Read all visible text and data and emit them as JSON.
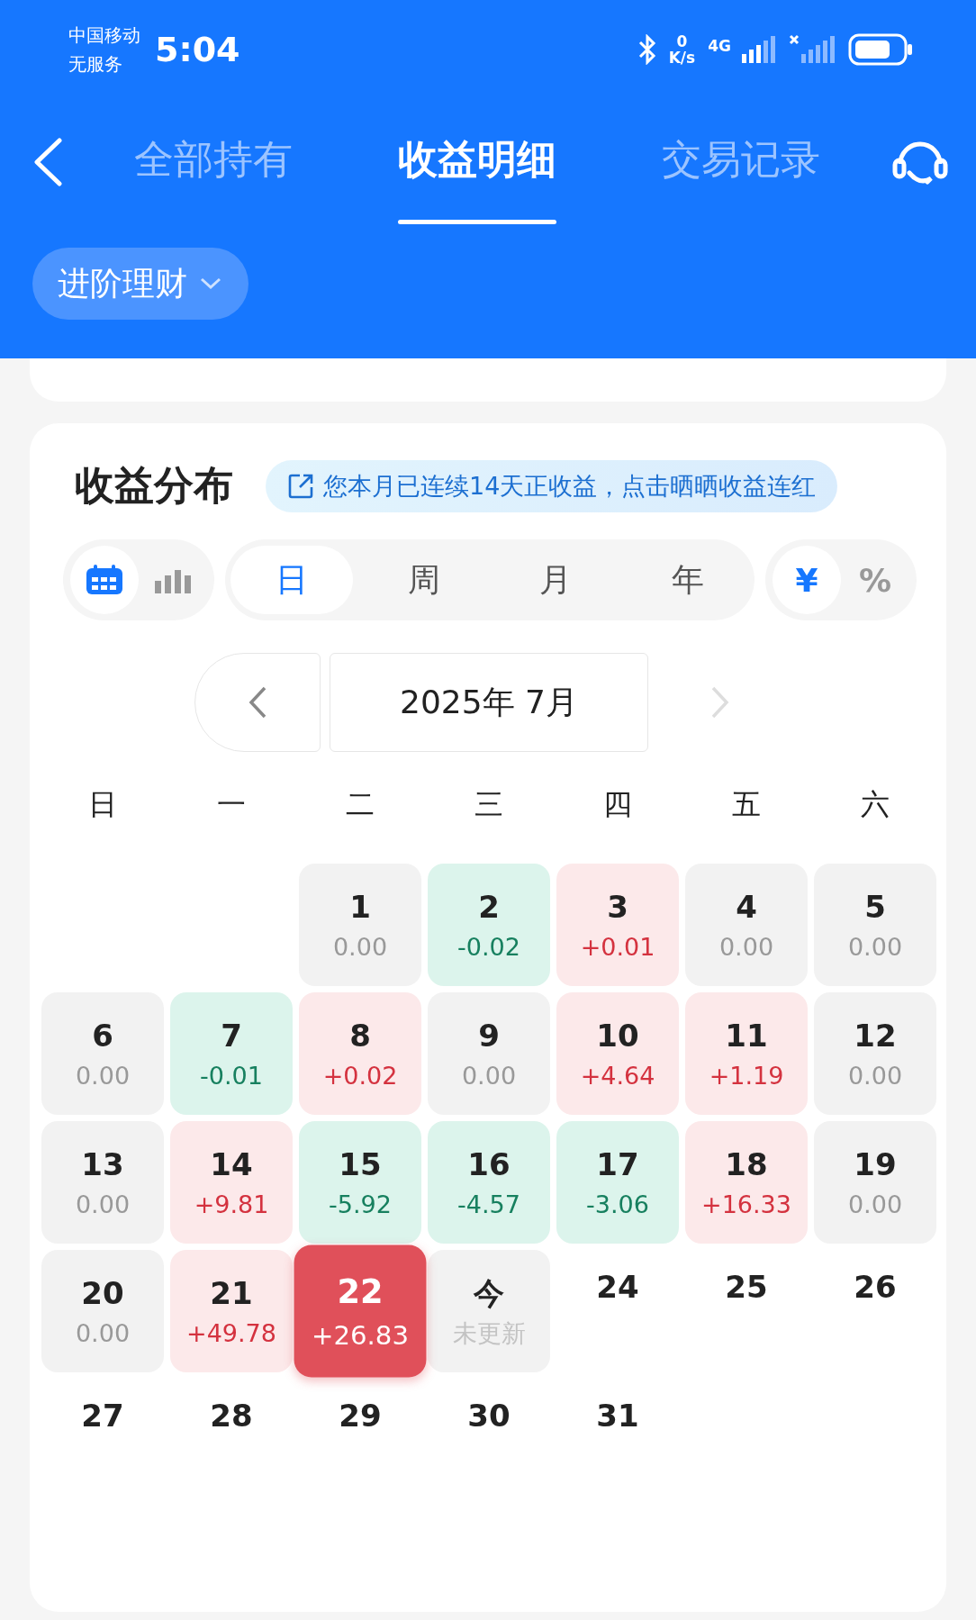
{
  "status_bar": {
    "carrier": "中国移动",
    "service": "无服务",
    "time": "5:04",
    "speed_value": "0",
    "speed_unit": "K/s",
    "network": "4G"
  },
  "tabs": [
    {
      "label": "全部持有",
      "selected": false
    },
    {
      "label": "收益明细",
      "selected": true
    },
    {
      "label": "交易记录",
      "selected": false
    }
  ],
  "filter_chip": {
    "label": "进阶理财"
  },
  "distribution": {
    "title": "收益分布",
    "banner": "您本月已连续14天正收益，点击晒晒收益连红",
    "view_toggle": [
      {
        "kind": "calendar",
        "selected": true
      },
      {
        "kind": "bars",
        "selected": false
      }
    ],
    "periods": [
      {
        "label": "日",
        "selected": true
      },
      {
        "label": "周",
        "selected": false
      },
      {
        "label": "月",
        "selected": false
      },
      {
        "label": "年",
        "selected": false
      }
    ],
    "units": [
      {
        "label": "¥",
        "selected": true
      },
      {
        "label": "%",
        "selected": false
      }
    ],
    "month_nav": {
      "label": "2025年 7月",
      "next_enabled": false
    },
    "weekdays": [
      "日",
      "一",
      "二",
      "三",
      "四",
      "五",
      "六"
    ],
    "weeks": [
      [
        {
          "kind": "empty"
        },
        {
          "kind": "empty"
        },
        {
          "kind": "zero",
          "day": "1",
          "value": "0.00",
          "selected": false
        },
        {
          "kind": "down",
          "day": "2",
          "value": "-0.02",
          "selected": false
        },
        {
          "kind": "up",
          "day": "3",
          "value": "+0.01",
          "selected": false
        },
        {
          "kind": "zero",
          "day": "4",
          "value": "0.00",
          "selected": false
        },
        {
          "kind": "zero",
          "day": "5",
          "value": "0.00",
          "selected": false
        }
      ],
      [
        {
          "kind": "zero",
          "day": "6",
          "value": "0.00",
          "selected": false
        },
        {
          "kind": "down",
          "day": "7",
          "value": "-0.01",
          "selected": false
        },
        {
          "kind": "up",
          "day": "8",
          "value": "+0.02",
          "selected": false
        },
        {
          "kind": "zero",
          "day": "9",
          "value": "0.00",
          "selected": false
        },
        {
          "kind": "up",
          "day": "10",
          "value": "+4.64",
          "selected": false
        },
        {
          "kind": "up",
          "day": "11",
          "value": "+1.19",
          "selected": false
        },
        {
          "kind": "zero",
          "day": "12",
          "value": "0.00",
          "selected": false
        }
      ],
      [
        {
          "kind": "zero",
          "day": "13",
          "value": "0.00",
          "selected": false
        },
        {
          "kind": "up",
          "day": "14",
          "value": "+9.81",
          "selected": false
        },
        {
          "kind": "down",
          "day": "15",
          "value": "-5.92",
          "selected": false
        },
        {
          "kind": "down",
          "day": "16",
          "value": "-4.57",
          "selected": false
        },
        {
          "kind": "down",
          "day": "17",
          "value": "-3.06",
          "selected": false
        },
        {
          "kind": "up",
          "day": "18",
          "value": "+16.33",
          "selected": false
        },
        {
          "kind": "zero",
          "day": "19",
          "value": "0.00",
          "selected": false
        }
      ],
      [
        {
          "kind": "zero",
          "day": "20",
          "value": "0.00",
          "selected": false
        },
        {
          "kind": "up",
          "day": "21",
          "value": "+49.78",
          "selected": false
        },
        {
          "kind": "up",
          "day": "22",
          "value": "+26.83",
          "selected": true
        },
        {
          "kind": "pending",
          "day": "今",
          "value": "未更新",
          "selected": false
        },
        {
          "kind": "future",
          "day": "24",
          "selected": false
        },
        {
          "kind": "future",
          "day": "25",
          "selected": false
        },
        {
          "kind": "future",
          "day": "26",
          "selected": false
        }
      ],
      [
        {
          "kind": "future",
          "day": "27",
          "selected": false
        },
        {
          "kind": "future",
          "day": "28",
          "selected": false
        },
        {
          "kind": "future",
          "day": "29",
          "selected": false
        },
        {
          "kind": "future",
          "day": "30",
          "selected": false
        },
        {
          "kind": "future",
          "day": "31",
          "selected": false
        },
        {
          "kind": "empty"
        },
        {
          "kind": "empty"
        }
      ]
    ]
  }
}
